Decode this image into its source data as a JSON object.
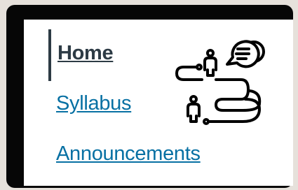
{
  "nav": {
    "items": [
      {
        "label": "Home",
        "active": true
      },
      {
        "label": "Syllabus",
        "active": false
      },
      {
        "label": "Announcements",
        "active": false
      }
    ]
  },
  "illustration": {
    "icon": "journey-path-people-chat-icon"
  },
  "colors": {
    "frame": "#060606",
    "background": "#e6e1db",
    "active_text": "#2d3b45",
    "link": "#0770a3"
  }
}
